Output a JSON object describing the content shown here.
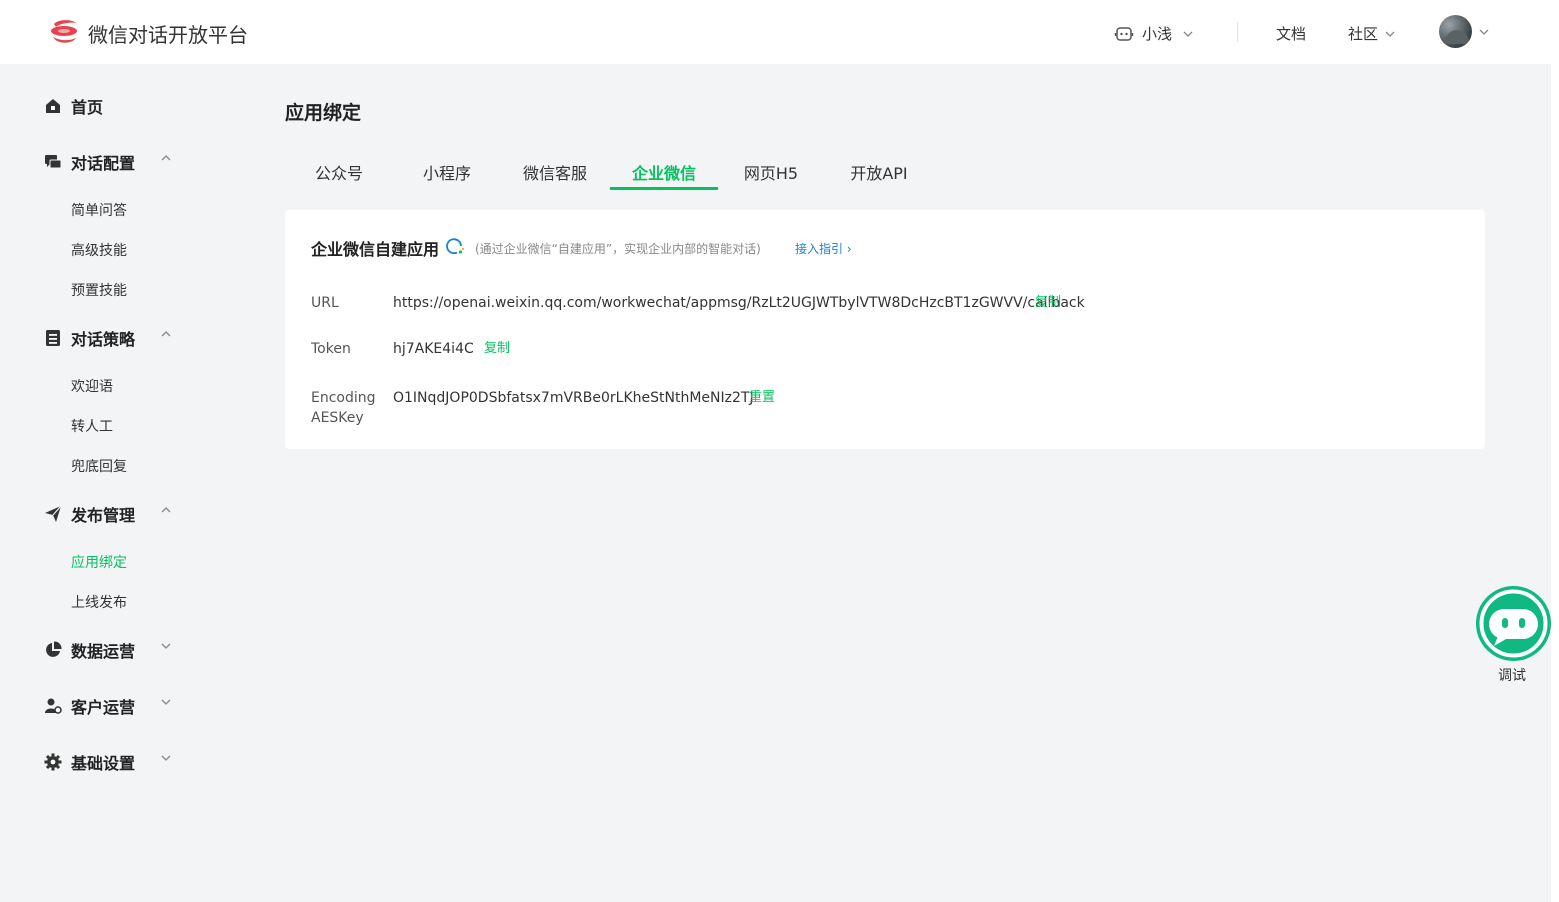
{
  "header": {
    "app_title": "微信对话开放平台",
    "bot_name": "小浅",
    "docs": "文档",
    "community": "社区",
    "brand_color": "#e8434d"
  },
  "sidebar": {
    "groups": [
      {
        "label": "首页",
        "icon": "home-icon"
      },
      {
        "label": "对话配置",
        "icon": "chat-config-icon",
        "items": [
          "简单问答",
          "高级技能",
          "预置技能"
        ]
      },
      {
        "label": "对话策略",
        "icon": "strategy-icon",
        "items": [
          "欢迎语",
          "转人工",
          "兜底回复"
        ]
      },
      {
        "label": "发布管理",
        "icon": "publish-icon",
        "items": [
          "应用绑定",
          "上线发布"
        ]
      },
      {
        "label": "数据运营",
        "icon": "pie-chart-icon"
      },
      {
        "label": "客户运营",
        "icon": "customer-icon"
      },
      {
        "label": "基础设置",
        "icon": "gear-icon"
      }
    ],
    "active_item": "应用绑定"
  },
  "main": {
    "page_title": "应用绑定",
    "tabs": [
      "公众号",
      "小程序",
      "微信客服",
      "企业微信",
      "网页H5",
      "开放API"
    ],
    "active_tab": "企业微信",
    "card": {
      "title": "企业微信自建应用",
      "desc": "(通过企业微信“自建应用”，实现企业内部的智能对话)",
      "guide_link": "接入指引",
      "rows": [
        {
          "label": "URL",
          "value": "https://openai.weixin.qq.com/workwechat/appmsg/RzLt2UGJWTbylVTW8DcHzcBT1zGWVV/callback",
          "action": "复制"
        },
        {
          "label": "Token",
          "value": "hj7AKE4i4C",
          "action": "复制"
        },
        {
          "label_line1": "Encoding",
          "label_line2": "AESKey",
          "value": "O1INqdJOP0DSbfatsx7mVRBe0rLKheStNthMeNIz2TJ",
          "action": "重置"
        }
      ]
    }
  },
  "debug": {
    "label": "调试"
  },
  "colors": {
    "accent": "#07c160",
    "link": "#1e7fd8"
  }
}
